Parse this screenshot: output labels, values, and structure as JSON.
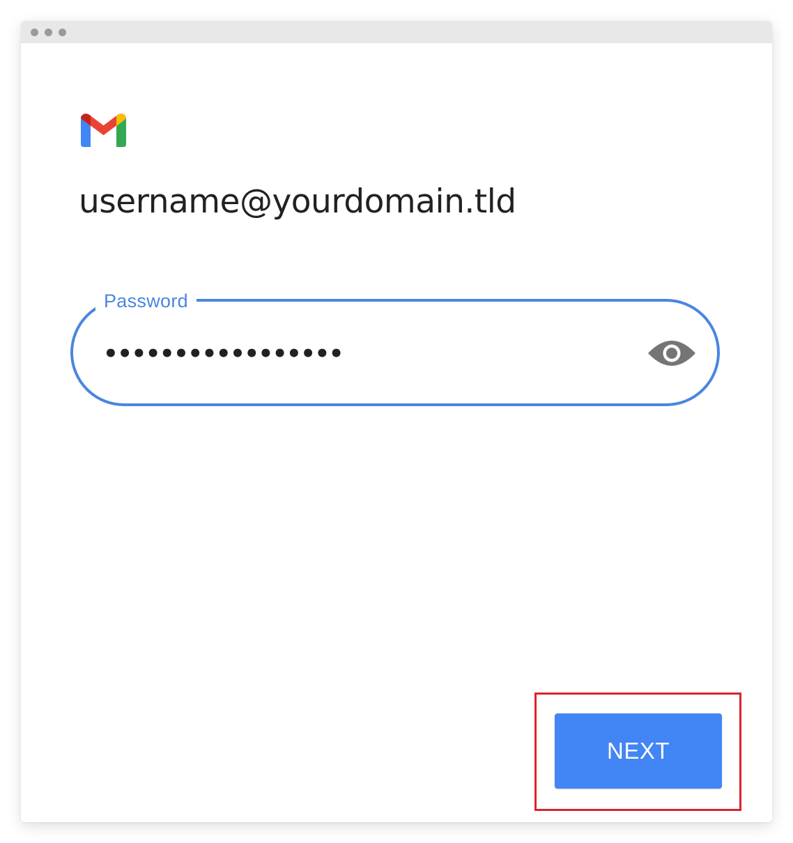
{
  "window": {
    "title_dots": [
      "dot-1",
      "dot-2",
      "dot-3"
    ]
  },
  "logo": {
    "icon": "gmail-logo-icon",
    "colors": {
      "blue": "#4285f4",
      "red": "#ea4335",
      "dark_red": "#c5221f",
      "yellow": "#fbbc04",
      "green": "#34a853"
    }
  },
  "account": {
    "email": "username@yourdomain.tld"
  },
  "password_field": {
    "label": "Password",
    "value": "•••••••••••••••••",
    "toggle_icon": "eye-icon",
    "accent_color": "#4a86e0"
  },
  "actions": {
    "next_label": "NEXT",
    "next_color": "#4285f4",
    "highlight_color": "#d9232d"
  }
}
